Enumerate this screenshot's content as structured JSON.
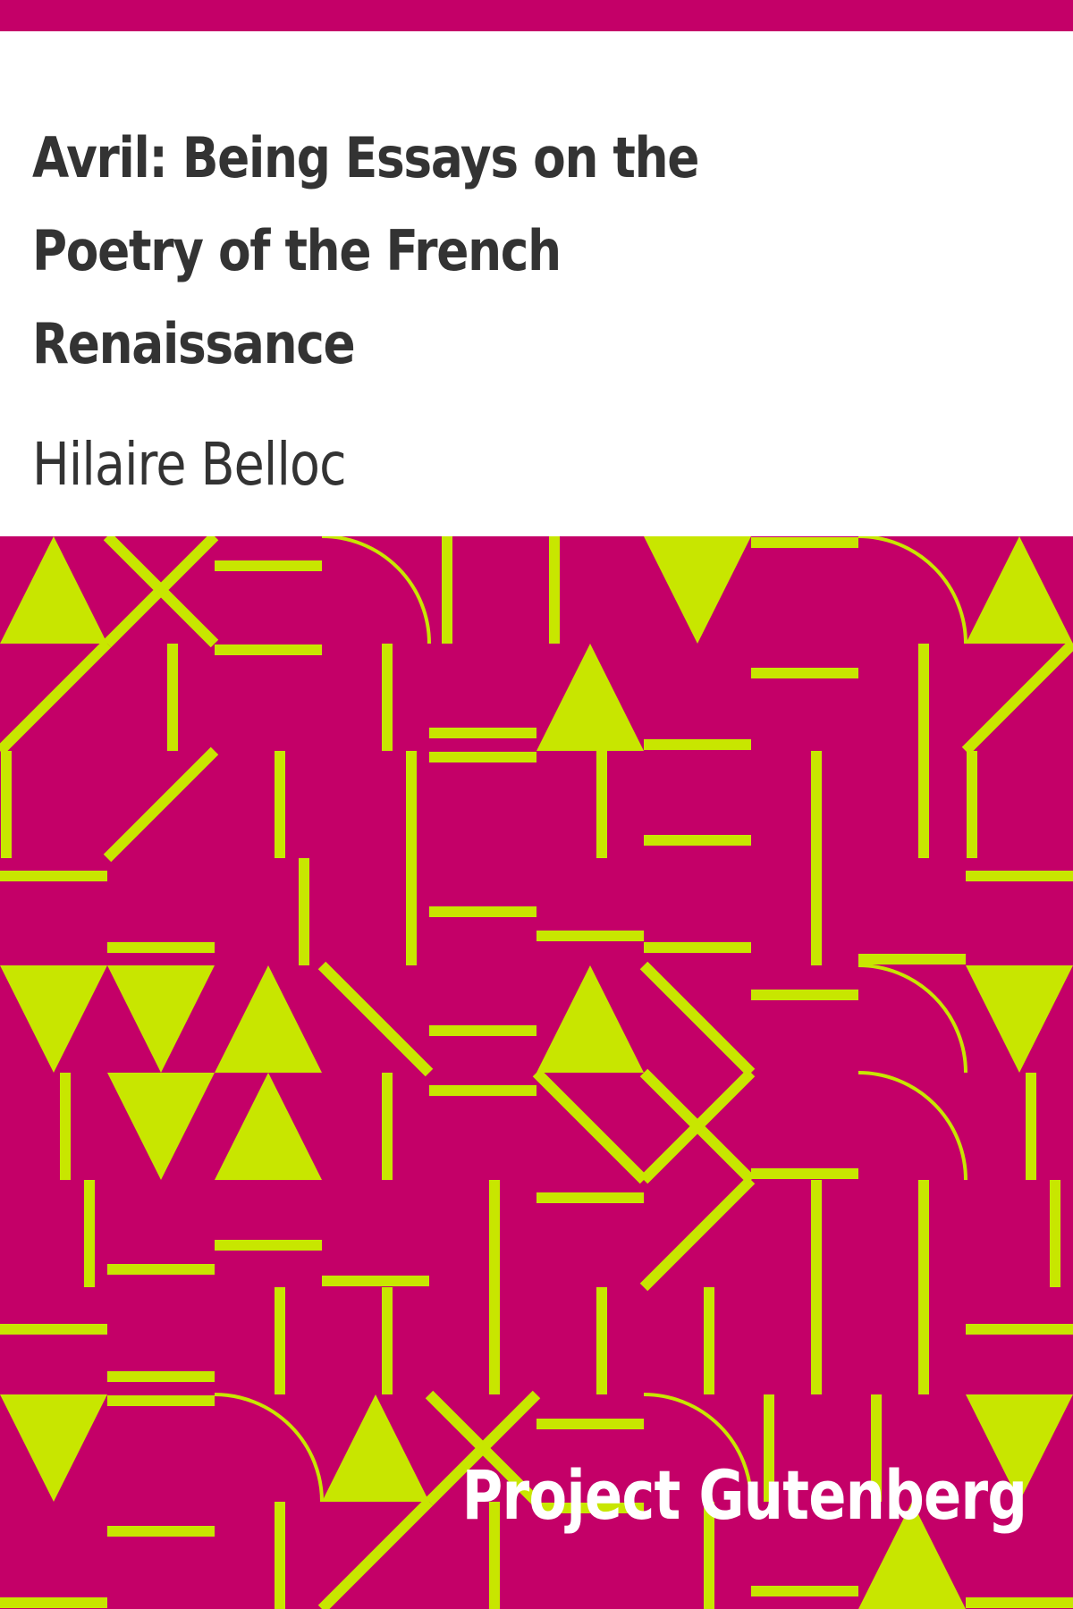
{
  "cover": {
    "title": "Avril: Being Essays on the Poetry of the French Renaissance",
    "author": "Hilaire Belloc",
    "publisher": "Project Gutenberg"
  },
  "colors": {
    "brand_magenta": "#c40068",
    "pattern_accent": "#c8e600",
    "title_text": "#333333",
    "publisher_text": "#ffffff"
  }
}
